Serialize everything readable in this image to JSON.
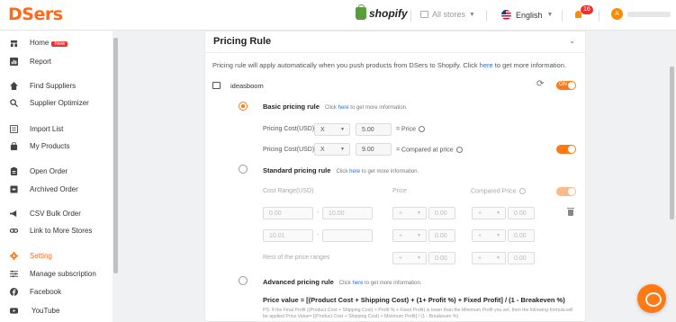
{
  "brand": {
    "logo": "DSers",
    "platform": "shopify",
    "accent": "#ff7a14"
  },
  "header": {
    "store_selector": "All stores",
    "language": "English",
    "notification_count": "16",
    "avatar_initial": "A"
  },
  "sidebar": {
    "items": [
      {
        "label": "Home",
        "icon": "home-icon",
        "badge": "New"
      },
      {
        "label": "Report",
        "icon": "chart-icon"
      },
      {
        "label": "Find Suppliers",
        "icon": "compass-icon"
      },
      {
        "label": "Supplier Optimizer",
        "icon": "search-icon"
      },
      {
        "label": "Import List",
        "icon": "list-icon"
      },
      {
        "label": "My Products",
        "icon": "bag-icon"
      },
      {
        "label": "Open Order",
        "icon": "clipboard-icon"
      },
      {
        "label": "Archived Order",
        "icon": "archive-icon"
      },
      {
        "label": "CSV Bulk Order",
        "icon": "megaphone-icon"
      },
      {
        "label": "Link to More Stores",
        "icon": "link-icon"
      },
      {
        "label": "Setting",
        "icon": "gear-icon",
        "active": true
      },
      {
        "label": "Manage subscription",
        "icon": "sliders-icon"
      },
      {
        "label": "Facebook",
        "icon": "facebook-icon"
      },
      {
        "label": "YouTube",
        "icon": "youtube-icon"
      }
    ]
  },
  "pricing": {
    "title": "Pricing Rule",
    "description_pre": "Pricing rule will apply automatically when you push products from DSers to Shopify. Click ",
    "description_link": "here",
    "description_post": " to get more information.",
    "store_name": "ideasboom",
    "store_toggle": "ON",
    "basic": {
      "title": "Basic pricing rule",
      "hint_pre": "Click ",
      "hint_link": "here",
      "hint_post": " to get more information.",
      "row1_label": "Pricing Cost(USD)",
      "row1_op": "X",
      "row1_value": "5.00",
      "row1_suffix": "= Price",
      "row2_label": "Pricing Cost(USD)",
      "row2_op": "X",
      "row2_value": "9.00",
      "row2_suffix": "= Compared at price"
    },
    "standard": {
      "title": "Standard pricing rule",
      "hint_pre": "Click ",
      "hint_link": "here",
      "hint_post": " to get more information.",
      "col_cost_range": "Cost Range(USD)",
      "col_price": "Price",
      "col_compared": "Compared Price",
      "rows": [
        {
          "from": "0.00",
          "to": "10.00",
          "op1": "+",
          "v1": "0.00",
          "op2": "+",
          "v2": "0.00"
        },
        {
          "from": "10.01",
          "to": "",
          "op1": "+",
          "v1": "0.00",
          "op2": "+",
          "v2": "0.00"
        }
      ],
      "rest_label": "Rest of the price ranges",
      "rest_op1": "+",
      "rest_v1": "0.00",
      "rest_op2": "+",
      "rest_v2": "0.00",
      "dash": "-"
    },
    "advanced": {
      "title": "Advanced pricing rule",
      "hint_pre": "Click ",
      "hint_link": "here",
      "hint_post": " to get more information.",
      "formula": "Price value = [(Product Cost + Shipping Cost) + (1+ Profit %) + Fixed Profit] / (1 - Breakeven %)",
      "ps": "PS: If the Final Profit ((Product Cost + Shipping Cost) × Profit % + Fixed Profit) is lower than the Minimum Profit you set, then the following formula will be applied Price Value= [(Product Cost + Shipping Cost) + Minimum Profit] / (1 - Breakeven %)"
    }
  }
}
